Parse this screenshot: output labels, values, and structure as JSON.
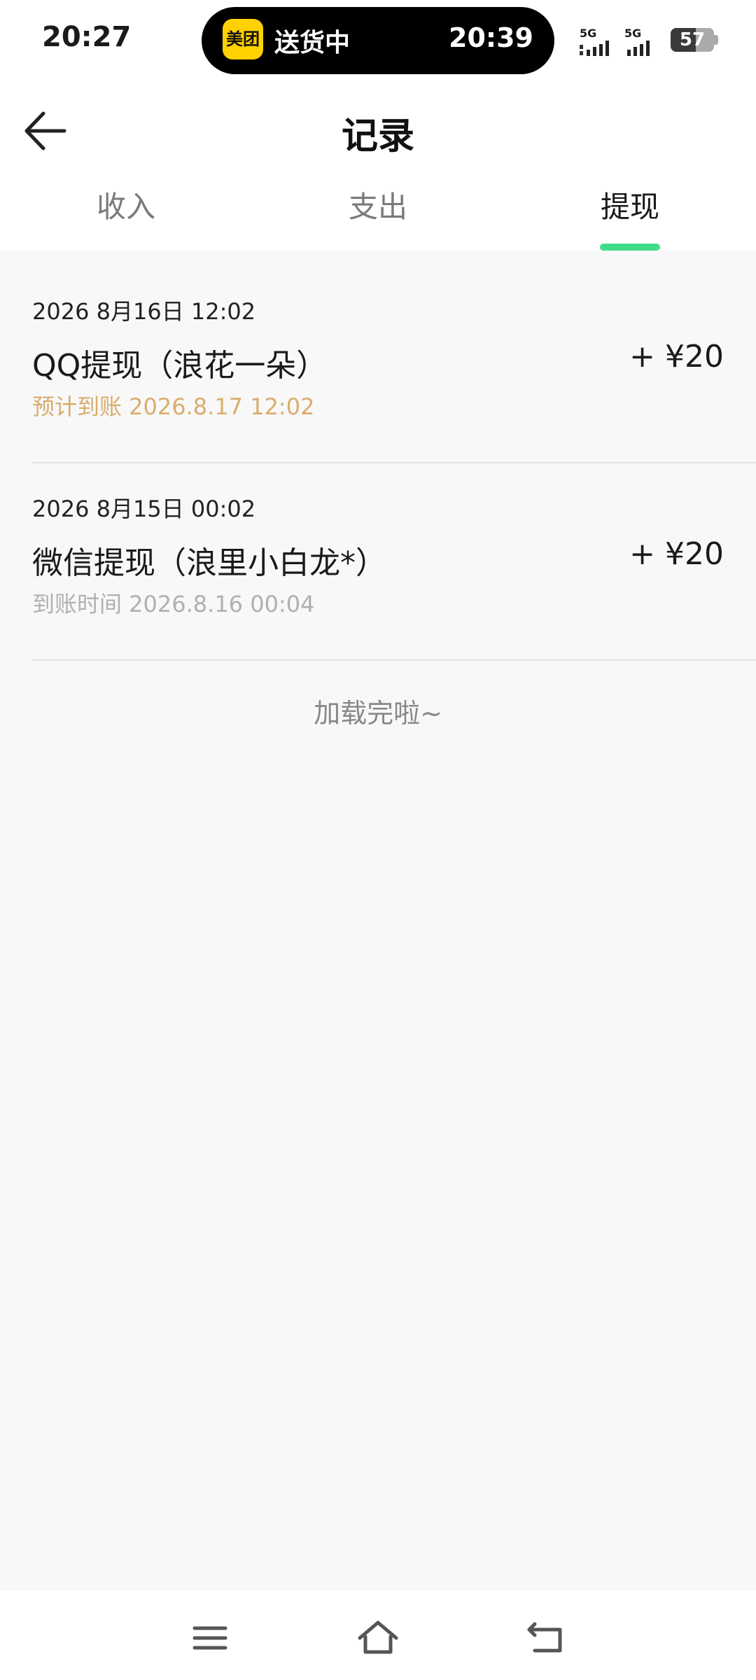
{
  "status_bar": {
    "time": "20:27",
    "island": {
      "app_logo_text": "美团",
      "status": "送货中",
      "time": "20:39"
    },
    "network1": "5G",
    "network2": "5G",
    "battery": "57"
  },
  "header": {
    "title": "记录",
    "back_icon": "arrow-left-icon"
  },
  "tabs": [
    {
      "label": "收入",
      "active": false
    },
    {
      "label": "支出",
      "active": false
    },
    {
      "label": "提现",
      "active": true
    }
  ],
  "colors": {
    "accent": "#3fdc8a",
    "pending": "#d9ad6c",
    "muted": "#b0b0b0"
  },
  "records": [
    {
      "date": "2026 8月16日 12:02",
      "title": "QQ提现（浪花一朵）",
      "amount": "+ ¥20",
      "sub": "预计到账 2026.8.17 12:02"
    },
    {
      "date": "2026 8月15日 00:02",
      "title": "微信提现（浪里小白龙*）",
      "amount": "+ ¥20",
      "sub": "到账时间 2026.8.16 00:04"
    }
  ],
  "footer_text": "加载完啦~",
  "nav_bar": {
    "menu_icon": "menu-icon",
    "home_icon": "home-icon",
    "back_icon": "back-icon"
  }
}
